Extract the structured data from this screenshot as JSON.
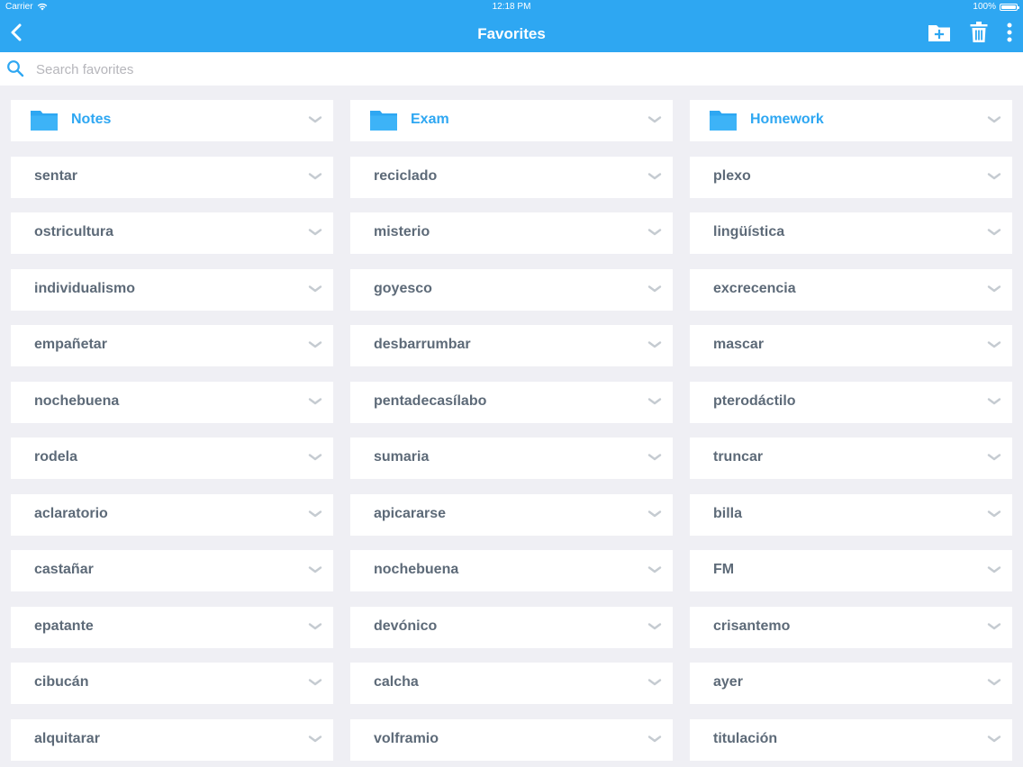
{
  "status": {
    "carrier": "Carrier",
    "time": "12:18 PM",
    "battery": "100%"
  },
  "nav": {
    "title": "Favorites",
    "accent": "#2ea7f2"
  },
  "search": {
    "placeholder": "Search favorites",
    "value": ""
  },
  "folders": [
    {
      "label": "Notes"
    },
    {
      "label": "Exam"
    },
    {
      "label": "Homework"
    }
  ],
  "rows": [
    [
      "sentar",
      "reciclado",
      "plexo"
    ],
    [
      "ostricultura",
      "misterio",
      "lingüística"
    ],
    [
      "individualismo",
      "goyesco",
      "excrecencia"
    ],
    [
      "empañetar",
      "desbarrumbar",
      "mascar"
    ],
    [
      "nochebuena",
      "pentadecasílabo",
      "pterodáctilo"
    ],
    [
      "rodela",
      "sumaria",
      "truncar"
    ],
    [
      "aclaratorio",
      "apicararse",
      "billa"
    ],
    [
      "castañar",
      "nochebuena",
      "FM"
    ],
    [
      "epatante",
      "devónico",
      "crisantemo"
    ],
    [
      "cibucán",
      "calcha",
      "ayer"
    ],
    [
      "alquitarar",
      "volframio",
      "titulación"
    ]
  ]
}
